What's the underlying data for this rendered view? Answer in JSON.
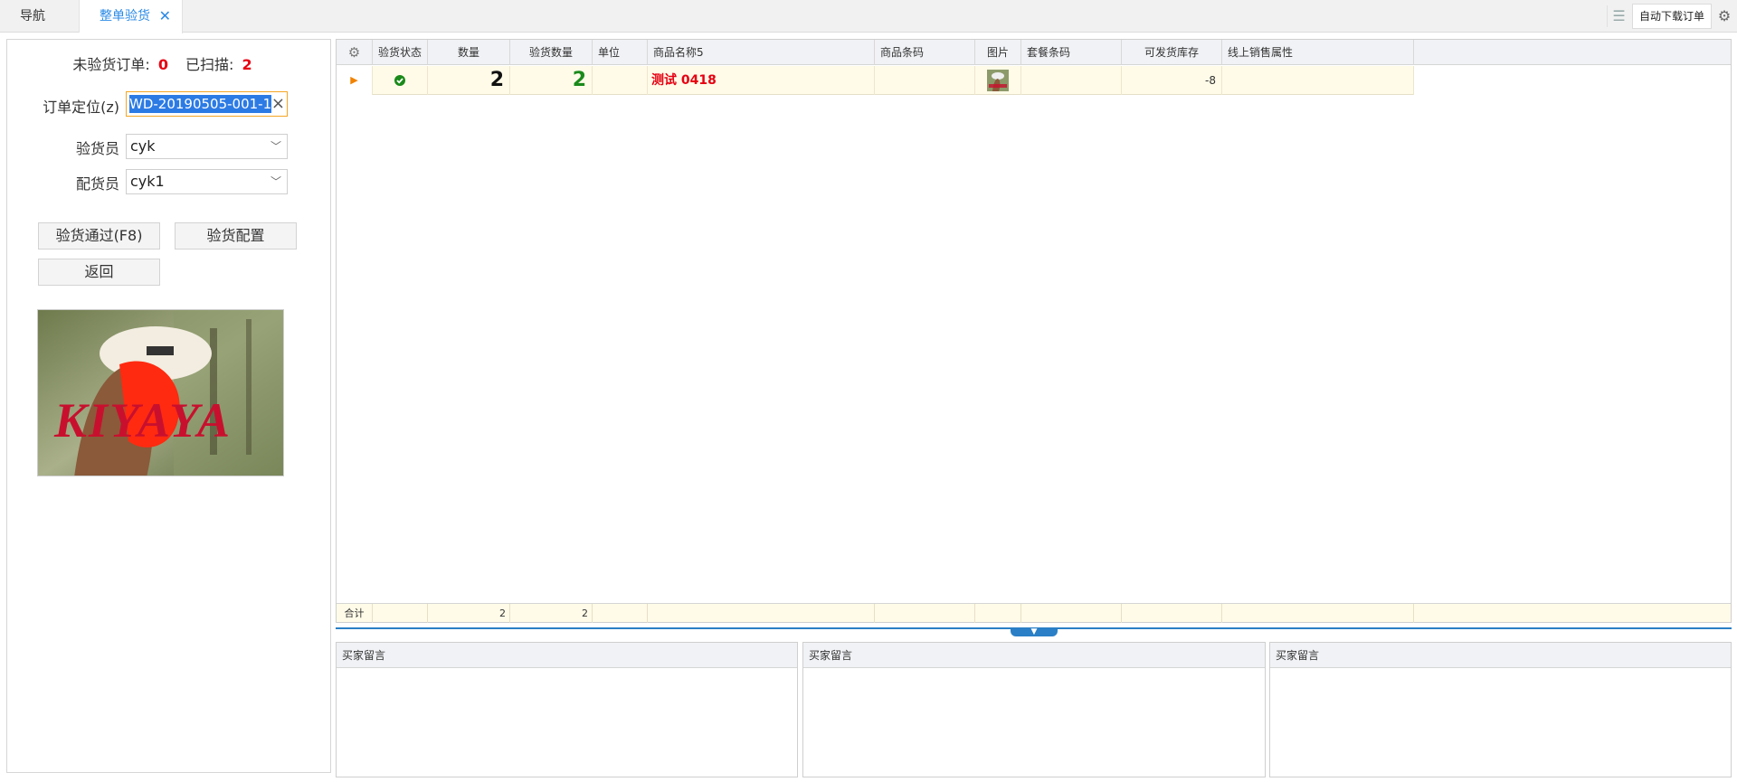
{
  "tabs": {
    "nav_label": "导航",
    "active_label": "整单验货",
    "close_glyph": "✕"
  },
  "toolbar": {
    "auto_download_label": "自动下载订单",
    "list_icon": "list-icon",
    "gear_icon": "gear-icon"
  },
  "left": {
    "unverified_label": "未验货订单:",
    "unverified_count": "0",
    "scanned_label": "已扫描:",
    "scanned_count": "2",
    "order_locate_label": "订单定位(z)",
    "order_locate_value": "WD-20190505-001-1-",
    "inspector_label": "验货员",
    "inspector_value": "cyk",
    "picker_label": "配货员",
    "picker_value": "cyk1",
    "pass_button": "验货通过(F8)",
    "config_button": "验货配置",
    "back_button": "返回",
    "photo_text": "KIYAYA"
  },
  "grid": {
    "headers": [
      "验货状态",
      "数量",
      "验货数量",
      "单位",
      "商品名称5",
      "商品条码",
      "图片",
      "套餐条码",
      "可发货库存",
      "线上销售属性"
    ],
    "rows": [
      {
        "status_icon": "check-circle-icon",
        "qty": "2",
        "verified_qty": "2",
        "unit": "",
        "name": "测试 0418",
        "barcode": "",
        "package_barcode": "",
        "stock": "-8",
        "online_attr": ""
      }
    ],
    "footer": {
      "label": "合计",
      "qty_total": "2",
      "verified_total": "2"
    }
  },
  "messages": {
    "panel1_title": "买家留言",
    "panel2_title": "买家留言",
    "panel3_title": "买家留言"
  },
  "colors": {
    "accent": "#2a8ae6",
    "red": "#e60012",
    "green": "#1a8a1a",
    "row_bg": "#fffbe8"
  }
}
